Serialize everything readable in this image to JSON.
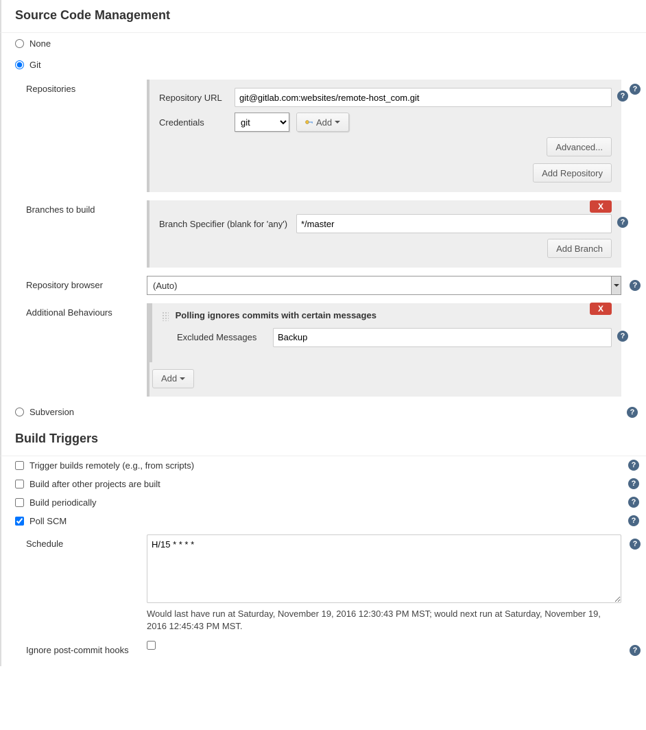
{
  "scm": {
    "heading": "Source Code Management",
    "options": {
      "none": "None",
      "git": "Git",
      "svn": "Subversion"
    },
    "repos_label": "Repositories",
    "repo_url_label": "Repository URL",
    "repo_url": "git@gitlab.com:websites/remote-host_com.git",
    "creds_label": "Credentials",
    "creds_value": "git",
    "add_cred_btn": "Add",
    "advanced_btn": "Advanced...",
    "add_repo_btn": "Add Repository",
    "branches_label": "Branches to build",
    "branch_spec_label": "Branch Specifier (blank for 'any')",
    "branch_spec": "*/master",
    "add_branch_btn": "Add Branch",
    "delete_x": "X",
    "repo_browser_label": "Repository browser",
    "repo_browser_value": "(Auto)",
    "addl_behav_label": "Additional Behaviours",
    "behav_title": "Polling ignores commits with certain messages",
    "excluded_label": "Excluded Messages",
    "excluded_value": "Backup",
    "add_behav_btn": "Add"
  },
  "triggers": {
    "heading": "Build Triggers",
    "remote": "Trigger builds remotely (e.g., from scripts)",
    "after": "Build after other projects are built",
    "periodic": "Build periodically",
    "poll": "Poll SCM",
    "schedule_label": "Schedule",
    "schedule_value": "H/15 * * * *",
    "schedule_msg": "Would last have run at Saturday, November 19, 2016 12:30:43 PM MST; would next run at Saturday, November 19, 2016 12:45:43 PM MST.",
    "ignore_hooks": "Ignore post-commit hooks"
  }
}
